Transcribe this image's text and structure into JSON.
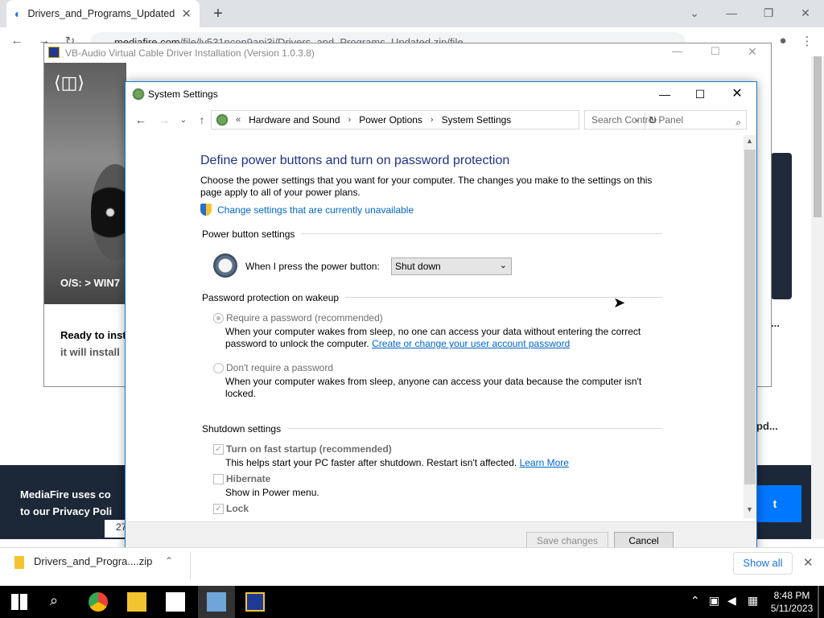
{
  "browser": {
    "tab_title": "Drivers_and_Programs_Updated",
    "new_tab": "+",
    "url_host": "mediafire.com",
    "url_path": "/file/ly531ncon9api3i/Drivers_and_Programs_Updated.zip/file",
    "minimize": "—",
    "restore": "❐",
    "close": "✕"
  },
  "background_page": {
    "cookie_text_line1": "MediaFire uses co",
    "cookie_text_line2": "to our Privacy Poli",
    "cookie_button": "t",
    "side_text1": "...",
    "side_text2": "pd...",
    "page_number": "27"
  },
  "vb_window": {
    "title": "VB-Audio Virtual Cable Driver Installation (Version 1.0.3.8)",
    "os_label": "O/S: > WIN7",
    "ready_label": "Ready to inst",
    "install_label": "it will install"
  },
  "system_settings": {
    "title": "System Settings",
    "breadcrumb": [
      "Hardware and Sound",
      "Power Options",
      "System Settings"
    ],
    "breadcrumb_prefix": "«",
    "search_placeholder": "Search Control Panel",
    "heading": "Define power buttons and turn on password protection",
    "intro_line1": "Choose the power settings that you want for your computer. The changes you make to the settings on this",
    "intro_line2": "page apply to all of your power plans.",
    "change_settings_link": "Change settings that are currently unavailable",
    "power_button_section": "Power button settings",
    "power_button_label": "When I press the power button:",
    "power_button_value": "Shut down",
    "password_section": "Password protection on wakeup",
    "require_password_label": "Require a password (recommended)",
    "require_password_desc1": "When your computer wakes from sleep, no one can access your data without entering the correct",
    "require_password_desc2": "password to unlock the computer.",
    "create_password_link": "Create or change your user account password",
    "no_password_label": "Don't require a password",
    "no_password_desc1": "When your computer wakes from sleep, anyone can access your data because the computer isn't",
    "no_password_desc2": "locked.",
    "shutdown_section": "Shutdown settings",
    "fast_startup_label": "Turn on fast startup (recommended)",
    "fast_startup_desc": "This helps start your PC faster after shutdown. Restart isn't affected.",
    "learn_more_link": "Learn More",
    "hibernate_label": "Hibernate",
    "hibernate_desc": "Show in Power menu.",
    "lock_label": "Lock",
    "save_button": "Save changes",
    "cancel_button": "Cancel"
  },
  "downloads": {
    "file_name": "Drivers_and_Progra....zip",
    "show_all": "Show all"
  },
  "taskbar": {
    "time": "8:48 PM",
    "date": "5/11/2023"
  },
  "colors": {
    "accent_blue": "#1979ca",
    "heading_blue": "#1e3287",
    "link_blue": "#0066cc",
    "cookie_bg": "#1c2738",
    "mediafire_button": "#0077ff"
  }
}
